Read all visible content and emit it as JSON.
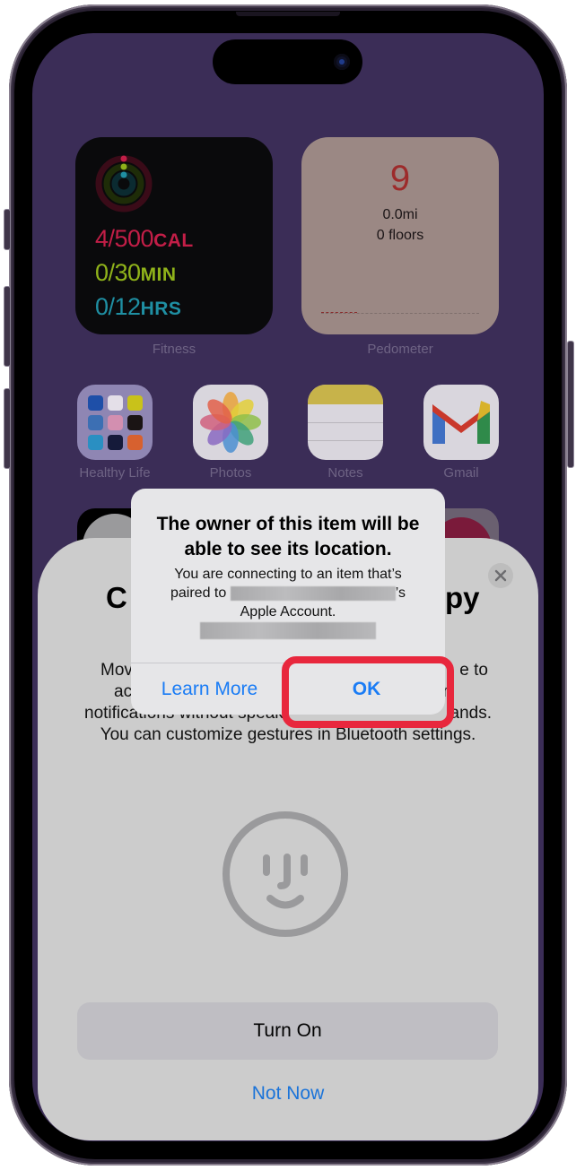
{
  "home": {
    "widgets": {
      "fitness": {
        "label": "Fitness",
        "move": {
          "value": "4/500",
          "unit": "CAL",
          "color": "#c21e47"
        },
        "exercise": {
          "value": "0/30",
          "unit": "MIN",
          "color": "#8fb21a"
        },
        "stand": {
          "value": "0/12",
          "unit": "HRS",
          "color": "#1f8fa3"
        }
      },
      "pedometer": {
        "label": "Pedometer",
        "steps": "9",
        "distance": "0.0mi",
        "floors": "0 floors"
      }
    },
    "apps": [
      {
        "label": "Healthy Life",
        "icon": "folder-icon"
      },
      {
        "label": "Photos",
        "icon": "photos-icon"
      },
      {
        "label": "Notes",
        "icon": "notes-icon"
      },
      {
        "label": "Gmail",
        "icon": "gmail-icon"
      }
    ]
  },
  "sheet": {
    "title_visible_start": "C",
    "title_visible_end": "py",
    "body_lines": [
      [
        "Mov",
        "e to"
      ],
      [
        "ac",
        "n"
      ],
      [
        "notifications without speak",
        "ands."
      ],
      [
        "You can customize gestures in Bluetooth settings.",
        ""
      ]
    ],
    "primary_button": "Turn On",
    "secondary_button": "Not Now"
  },
  "alert": {
    "title": "The owner of this item will be able to see its location.",
    "message_line1": "You are connecting to an item that’s",
    "message_paired_to": "paired to",
    "message_possessive": "’s",
    "message_line3": "Apple Account.",
    "learn_more_button": "Learn More",
    "ok_button": "OK"
  },
  "colors": {
    "accent_blue": "#1a7cf5",
    "highlight_red": "#e8273d",
    "wallpaper": "#3b2d57"
  }
}
